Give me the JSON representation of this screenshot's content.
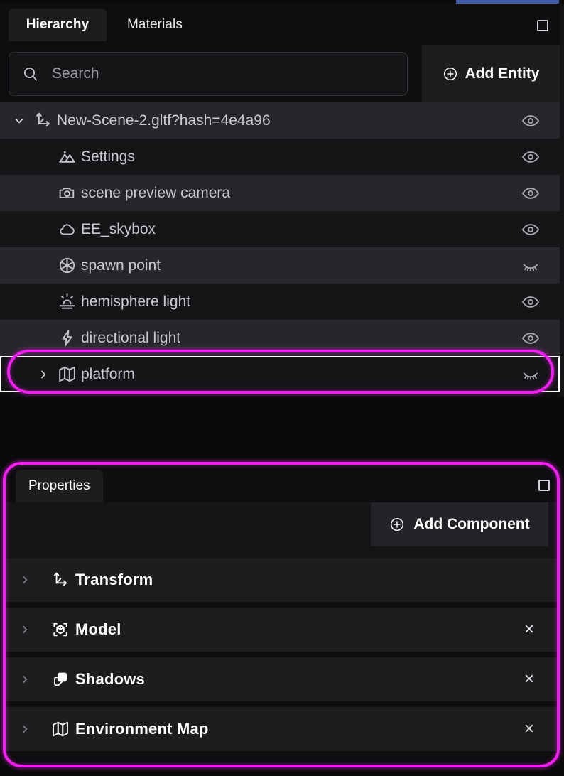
{
  "app": {
    "accent_blue": "#3f5aa6",
    "annotation_color": "#f11ff1"
  },
  "hierarchy_panel": {
    "tabs": [
      {
        "label": "Hierarchy",
        "active": true
      },
      {
        "label": "Materials",
        "active": false
      }
    ],
    "maximize_icon": "maximize-panel-icon",
    "search": {
      "placeholder": "Search",
      "value": "",
      "icon": "search-icon"
    },
    "add_entity": {
      "label": "Add Entity",
      "icon": "plus-circle-icon"
    },
    "tree": [
      {
        "label": "New-Scene-2.gltf?hash=4e4a96",
        "icon": "axes-icon",
        "twisty": "chevron-down-icon",
        "indent": 0,
        "visible": true,
        "stripe": "light",
        "selected": false
      },
      {
        "label": "Settings",
        "icon": "image-mountain-icon",
        "twisty": "",
        "indent": 1,
        "visible": true,
        "stripe": "dark",
        "selected": false
      },
      {
        "label": "scene preview camera",
        "icon": "camera-icon",
        "twisty": "",
        "indent": 1,
        "visible": true,
        "stripe": "light",
        "selected": false
      },
      {
        "label": "EE_skybox",
        "icon": "cloud-icon",
        "twisty": "",
        "indent": 1,
        "visible": true,
        "stripe": "dark",
        "selected": false
      },
      {
        "label": "spawn point",
        "icon": "aperture-icon",
        "twisty": "",
        "indent": 1,
        "visible": false,
        "stripe": "light",
        "selected": false
      },
      {
        "label": "hemisphere light",
        "icon": "sunrise-icon",
        "twisty": "",
        "indent": 1,
        "visible": true,
        "stripe": "dark",
        "selected": false
      },
      {
        "label": "directional light",
        "icon": "lightning-icon",
        "twisty": "",
        "indent": 1,
        "visible": true,
        "stripe": "light",
        "selected": false
      },
      {
        "label": "platform",
        "icon": "map-icon",
        "twisty": "chevron-right-icon",
        "indent": 1,
        "visible": false,
        "stripe": "dark",
        "selected": true
      }
    ]
  },
  "properties_panel": {
    "tab_label": "Properties",
    "maximize_icon": "maximize-panel-icon",
    "add_component": {
      "label": "Add Component",
      "icon": "plus-circle-icon"
    },
    "components": [
      {
        "label": "Transform",
        "icon": "axes-icon",
        "twisty": "chevron-right-icon",
        "removable": false,
        "close_label": ""
      },
      {
        "label": "Model",
        "icon": "cube-3d-icon",
        "twisty": "chevron-right-icon",
        "removable": true,
        "close_label": "×"
      },
      {
        "label": "Shadows",
        "icon": "shadow-icon",
        "twisty": "chevron-right-icon",
        "removable": true,
        "close_label": "×"
      },
      {
        "label": "Environment Map",
        "icon": "map-icon",
        "twisty": "chevron-right-icon",
        "removable": true,
        "close_label": "×"
      }
    ]
  }
}
